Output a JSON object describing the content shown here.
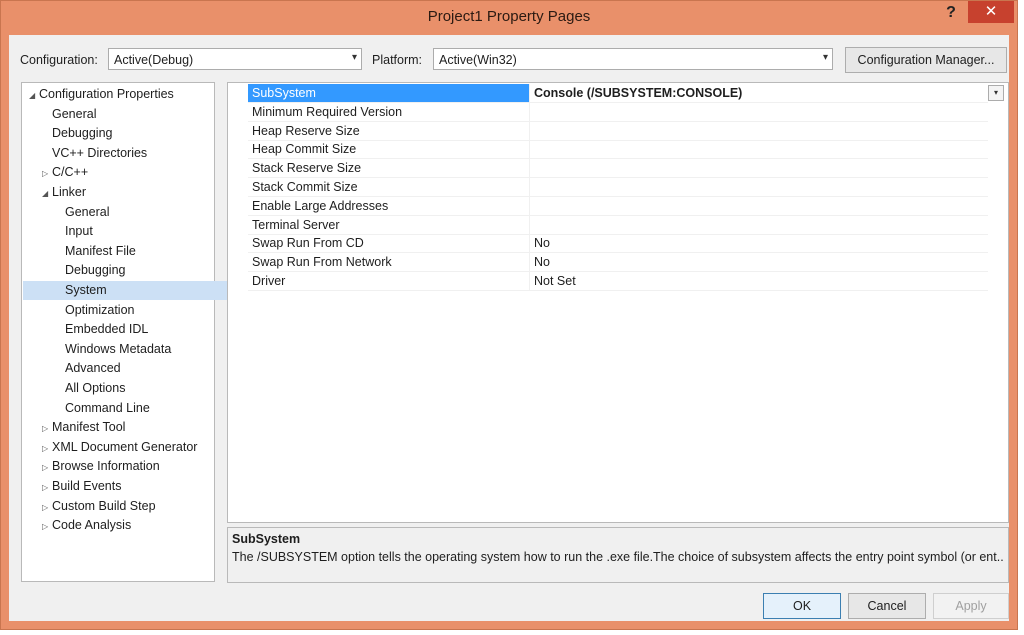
{
  "window": {
    "title": "Project1 Property Pages",
    "help_glyph": "?",
    "close_glyph": "✕"
  },
  "toolbar": {
    "configuration_label": "Configuration:",
    "configuration_value": "Active(Debug)",
    "platform_label": "Platform:",
    "platform_value": "Active(Win32)",
    "config_manager_label": "Configuration Manager..."
  },
  "tree": {
    "items": [
      {
        "label": "Configuration Properties",
        "glyph": "◢",
        "selected": false
      },
      {
        "label": "General",
        "glyph": "",
        "selected": false
      },
      {
        "label": "Debugging",
        "glyph": "",
        "selected": false
      },
      {
        "label": "VC++ Directories",
        "glyph": "",
        "selected": false
      },
      {
        "label": "C/C++",
        "glyph": "▷",
        "selected": false
      },
      {
        "label": "Linker",
        "glyph": "◢",
        "selected": false
      },
      {
        "label": "General",
        "glyph": "",
        "selected": false
      },
      {
        "label": "Input",
        "glyph": "",
        "selected": false
      },
      {
        "label": "Manifest File",
        "glyph": "",
        "selected": false
      },
      {
        "label": "Debugging",
        "glyph": "",
        "selected": false
      },
      {
        "label": "System",
        "glyph": "",
        "selected": true
      },
      {
        "label": "Optimization",
        "glyph": "",
        "selected": false
      },
      {
        "label": "Embedded IDL",
        "glyph": "",
        "selected": false
      },
      {
        "label": "Windows Metadata",
        "glyph": "",
        "selected": false
      },
      {
        "label": "Advanced",
        "glyph": "",
        "selected": false
      },
      {
        "label": "All Options",
        "glyph": "",
        "selected": false
      },
      {
        "label": "Command Line",
        "glyph": "",
        "selected": false
      },
      {
        "label": "Manifest Tool",
        "glyph": "▷",
        "selected": false
      },
      {
        "label": "XML Document Generator",
        "glyph": "▷",
        "selected": false
      },
      {
        "label": "Browse Information",
        "glyph": "▷",
        "selected": false
      },
      {
        "label": "Build Events",
        "glyph": "▷",
        "selected": false
      },
      {
        "label": "Custom Build Step",
        "glyph": "▷",
        "selected": false
      },
      {
        "label": "Code Analysis",
        "glyph": "▷",
        "selected": false
      }
    ]
  },
  "grid": {
    "rows": [
      {
        "name": "SubSystem",
        "value": "Console (/SUBSYSTEM:CONSOLE)"
      },
      {
        "name": "Minimum Required Version",
        "value": ""
      },
      {
        "name": "Heap Reserve Size",
        "value": ""
      },
      {
        "name": "Heap Commit Size",
        "value": ""
      },
      {
        "name": "Stack Reserve Size",
        "value": ""
      },
      {
        "name": "Stack Commit Size",
        "value": ""
      },
      {
        "name": "Enable Large Addresses",
        "value": ""
      },
      {
        "name": "Terminal Server",
        "value": ""
      },
      {
        "name": "Swap Run From CD",
        "value": "No"
      },
      {
        "name": "Swap Run From Network",
        "value": "No"
      },
      {
        "name": "Driver",
        "value": "Not Set"
      }
    ]
  },
  "description": {
    "title": "SubSystem",
    "text": "The /SUBSYSTEM option tells the operating system how to run the .exe file.The choice of subsystem affects the entry point symbol (or ent..."
  },
  "buttons": {
    "ok": "OK",
    "cancel": "Cancel",
    "apply": "Apply"
  },
  "colors": {
    "title_bar": "#e9906a",
    "selection": "#3399ff",
    "tree_selection": "#cce0f5",
    "close_button": "#c7412e"
  },
  "icons": {
    "combo_arrow": "▾",
    "dropdown_arrow": "▾"
  }
}
